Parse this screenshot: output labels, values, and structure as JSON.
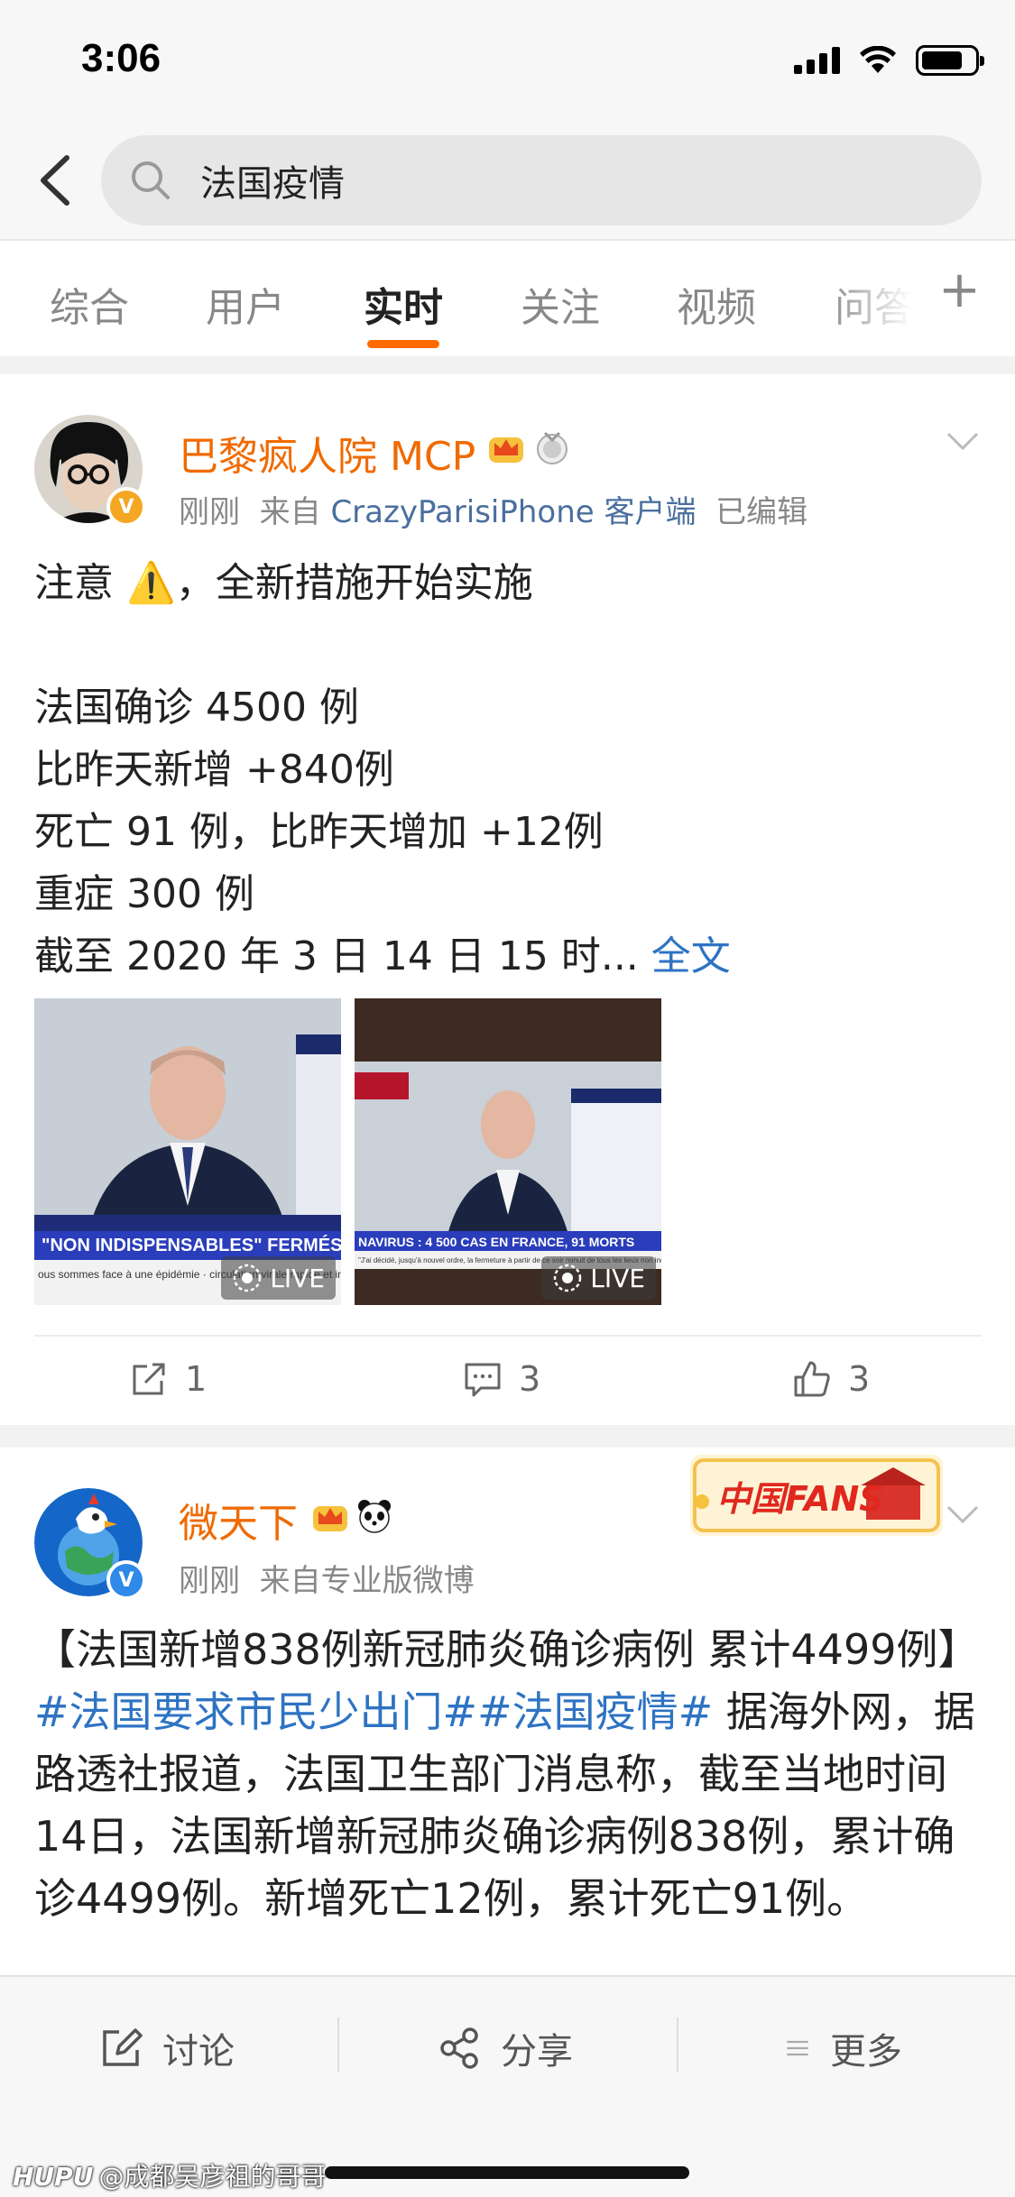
{
  "status_bar": {
    "time": "3:06"
  },
  "search": {
    "query": "法国疫情"
  },
  "tabs": [
    {
      "label": "综合"
    },
    {
      "label": "用户"
    },
    {
      "label": "实时"
    },
    {
      "label": "关注"
    },
    {
      "label": "视频"
    },
    {
      "label": "问答"
    }
  ],
  "tab_add_symbol": "+",
  "posts": [
    {
      "author": "巴黎疯人院 MCP",
      "time": "刚刚",
      "source_prefix": "来自",
      "source": "CrazyParisiPhone 客户端",
      "edited": "已编辑",
      "text": "注意 ⚠️，全新措施开始实施\n\n法国确诊 4500 例\n比昨天新增 +840例\n死亡 91 例，比昨天增加 +12例\n重症 300 例\n截至 2020 年 3 日 14 日 15 时... ",
      "full_link": "全文",
      "images": [
        {
          "ticker": "\"NON INDISPENSABLES\" FERMÉS",
          "subticker": "ous sommes face à une épidémie · circulation virale rapide et intens",
          "live_label": "LIVE"
        },
        {
          "ticker": "NAVIRUS : 4 500 CAS EN FRANCE, 91 MORTS",
          "subticker": "\"J'ai décidé, jusqu'à nouvel ordre, la fermeture à partir de ce soir minuit de tous les lieux non indispensab",
          "live_label": "LIVE"
        }
      ],
      "actions": {
        "repost": "1",
        "comment": "3",
        "like": "3"
      }
    },
    {
      "author": "微天下",
      "time": "刚刚",
      "source": "来自专业版微博",
      "text_lead": "【法国新增838例新冠肺炎确诊病例 累计4499例】",
      "hashtags": "#法国要求市民少出门##法国疫情#",
      "text_rest": " 据海外网，据路透社报道，法国卫生部门消息称，截至当地时间14日，法国新增新冠肺炎确诊病例838例，累计确诊4499例。新增死亡12例，累计死亡91例。",
      "banner_text": "中国FANS"
    }
  ],
  "bottom_bar": {
    "discuss": "讨论",
    "share": "分享",
    "more": "更多"
  },
  "watermark": {
    "brand": "HUPU",
    "text": "@成都吴彦祖的哥哥"
  },
  "colors": {
    "accent": "#ff6a00",
    "username": "#f06a00",
    "link": "#2e73c3"
  }
}
